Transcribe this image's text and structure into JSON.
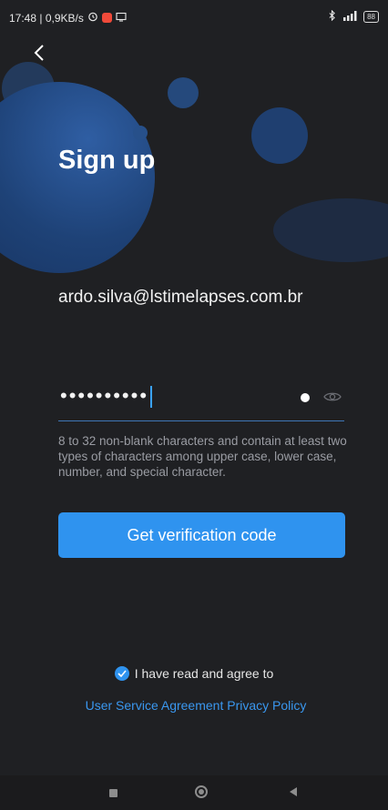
{
  "status_bar": {
    "time_speed": "17:48 | 0,9KB/s",
    "alarm_icon": "alarm-clock-icon",
    "screen_icon": "screen-cast-icon",
    "battery": "88"
  },
  "header": {
    "back_icon": "chevron-left-icon",
    "title": "Sign up"
  },
  "form": {
    "email": "ardo.silva@lstimelapses.com.br",
    "password_masked": "••••••••••",
    "show_password_icon": "eye-icon",
    "hint": "8 to 32 non-blank characters and contain at least two types of characters among upper case, lower case, number, and special character.",
    "submit_label": "Get verification code"
  },
  "agreement": {
    "checked": true,
    "text": "I have read and agree to",
    "link_user_service": "User Service Agreement",
    "link_privacy": "Privacy Policy"
  },
  "colors": {
    "accent": "#2f93ef",
    "background": "#1f2023",
    "link": "#3a97ef",
    "hint": "#9a9ca3"
  }
}
